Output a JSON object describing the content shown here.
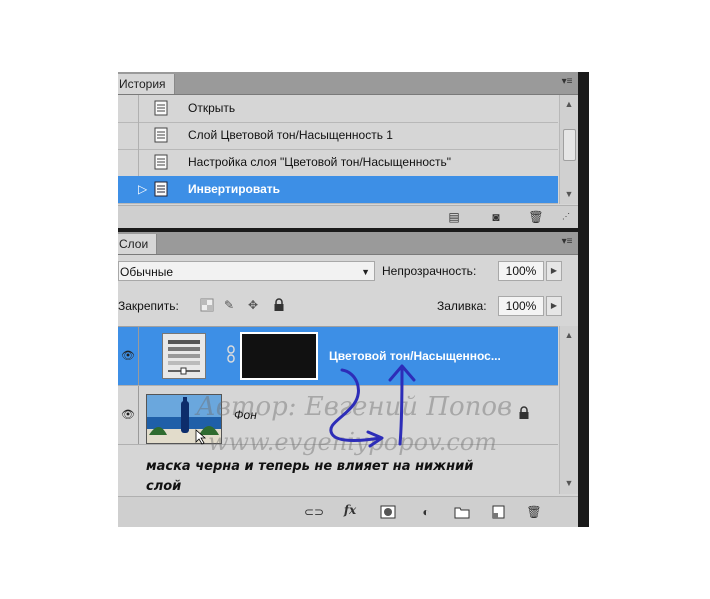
{
  "history": {
    "tab_label": "История",
    "menu_icon": "panel-menu-icon",
    "items": [
      {
        "label": "Открыть",
        "selected": false
      },
      {
        "label": "Слой Цветовой тон/Насыщенность 1",
        "selected": false
      },
      {
        "label": "Настройка слоя \"Цветовой тон/Насыщенность\"",
        "selected": false
      },
      {
        "label": "Инвертировать",
        "selected": true
      }
    ],
    "footer_icons": [
      "new-document-icon",
      "snapshot-camera-icon",
      "trash-icon"
    ]
  },
  "layers": {
    "tab_label": "Слои",
    "blend_mode": "Обычные",
    "opacity_label": "Непрозрачность:",
    "opacity_value": "100%",
    "lock_label": "Закрепить:",
    "lock_icons": [
      "lock-transparent-icon",
      "lock-brush-icon",
      "lock-move-icon",
      "lock-all-icon"
    ],
    "fill_label": "Заливка:",
    "fill_value": "100%",
    "items": [
      {
        "name": "Цветовой тон/Насыщеннос...",
        "selected": true,
        "type": "adjustment"
      },
      {
        "name": "Фон",
        "selected": false,
        "type": "background",
        "locked": true
      }
    ],
    "footer_icons": [
      "link-layers-icon",
      "fx-icon",
      "add-mask-icon",
      "adjustment-layer-icon",
      "group-folder-icon",
      "new-layer-icon",
      "trash-icon"
    ],
    "fx_text": "fx"
  },
  "annotation": {
    "caption_line1": "маска черна и теперь не влияет на нижний",
    "caption_line2": "слой",
    "watermark_line1": "Автор: Евгений Попов",
    "watermark_line2": "www.evgeniypopov.com",
    "arrow_color": "#2d2db8"
  },
  "colors": {
    "selection": "#3d8fe6",
    "panel_bg": "#d6d6d6",
    "tab_bar": "#9a9a9a"
  }
}
